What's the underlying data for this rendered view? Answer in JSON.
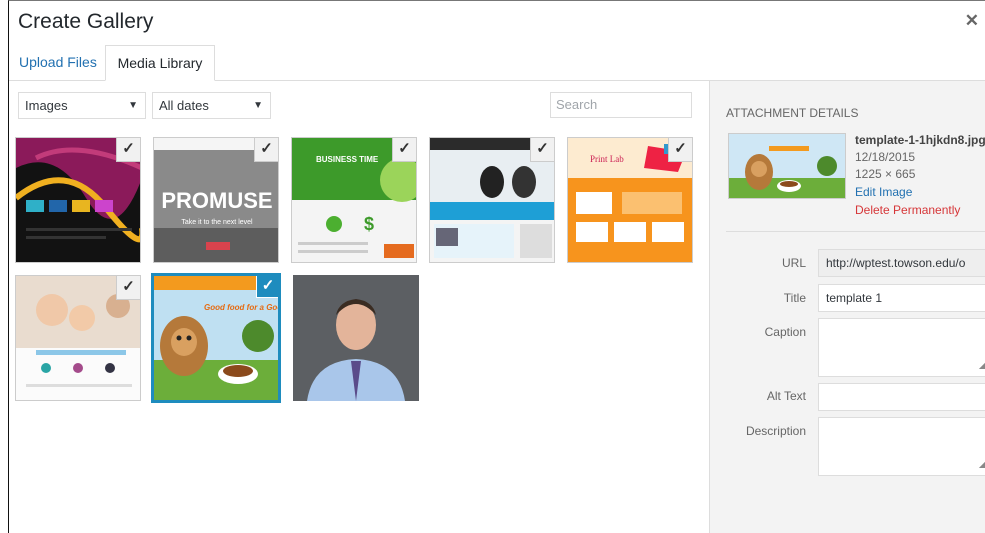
{
  "modal": {
    "title": "Create Gallery",
    "close_glyph": "✕"
  },
  "tabs": [
    {
      "label": "Upload Files"
    },
    {
      "label": "Media Library"
    }
  ],
  "filters": {
    "type_value": "Images",
    "date_value": "All dates",
    "search_placeholder": "Search"
  },
  "grid": {
    "items": [
      {
        "alt": "dark website template thumbnail",
        "selected": true,
        "active": false
      },
      {
        "alt": "PROMUSE website template thumbnail",
        "selected": true,
        "active": false,
        "visible_text": "PROMUSE",
        "subtext": "Take it to the next level"
      },
      {
        "alt": "BUSINESS TIME website template thumbnail",
        "selected": true,
        "active": false,
        "visible_text": "BUSINESS TIME"
      },
      {
        "alt": "graduation website template thumbnail",
        "selected": true,
        "active": false
      },
      {
        "alt": "Print Lab website template thumbnail",
        "selected": true,
        "active": false,
        "visible_text": "Print Lab"
      },
      {
        "alt": "family website template thumbnail",
        "selected": true,
        "active": false
      },
      {
        "alt": "dog food website template thumbnail",
        "selected": true,
        "active": true,
        "visible_text": "Good food for a Good Buddy"
      },
      {
        "alt": "portrait photo of man in blue shirt",
        "selected": false,
        "active": false
      }
    ],
    "check_glyph": "✓"
  },
  "attachment": {
    "heading": "ATTACHMENT DETAILS",
    "filename": "template-1-1hjkdn8.jpg",
    "date": "12/18/2015",
    "dimensions": "1225 × 665",
    "edit_link": "Edit Image",
    "delete_link": "Delete Permanently",
    "fields": {
      "url_label": "URL",
      "url_value": "http://wptest.towson.edu/o",
      "title_label": "Title",
      "title_value": "template 1",
      "caption_label": "Caption",
      "caption_value": "",
      "alt_label": "Alt Text",
      "alt_value": "",
      "description_label": "Description",
      "description_value": ""
    }
  },
  "colors": {
    "accent": "#1e8cbe",
    "link": "#2271b1",
    "danger": "#d63638",
    "sidebar_bg": "#f3f3f3"
  }
}
